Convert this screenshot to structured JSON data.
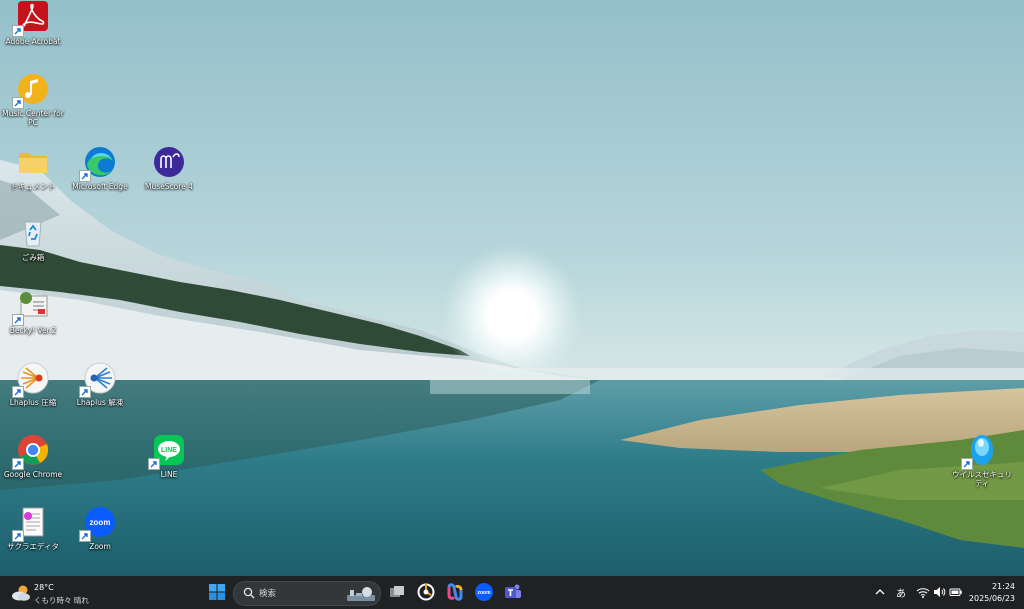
{
  "desktop": {
    "icons": [
      {
        "label": "Adobe Acrobat",
        "icon": "adobe-acrobat-icon"
      },
      {
        "label": "Music Center for PC",
        "icon": "music-center-icon"
      },
      {
        "label": "ドキュメント",
        "icon": "folder-icon"
      },
      {
        "label": "Microsoft Edge",
        "icon": "edge-icon"
      },
      {
        "label": "MuseScore 4",
        "icon": "musescore-icon"
      },
      {
        "label": "ごみ箱",
        "icon": "recycle-bin-icon"
      },
      {
        "label": "Becky! Ver.2",
        "icon": "becky-icon"
      },
      {
        "label": "Lhaplus 圧縮",
        "icon": "lhaplus-compress-icon"
      },
      {
        "label": "Lhaplus 解凍",
        "icon": "lhaplus-extract-icon"
      },
      {
        "label": "Google Chrome",
        "icon": "chrome-icon"
      },
      {
        "label": "LINE",
        "icon": "line-icon"
      },
      {
        "label": "サクラエディタ",
        "icon": "sakura-editor-icon"
      },
      {
        "label": "Zoom",
        "icon": "zoom-icon"
      },
      {
        "label": "ウイルスセキュリティ",
        "icon": "virus-security-icon"
      }
    ]
  },
  "taskbar": {
    "weather": {
      "temp": "28°C",
      "condition": "くもり時々 晴れ"
    },
    "search": {
      "placeholder": "検索"
    },
    "pinned": [
      "start-icon",
      "task-view-icon",
      "media-app-icon",
      "copilot-icon",
      "zoom-icon",
      "teams-icon"
    ],
    "tray": {
      "ime": "あ",
      "time": "21:24",
      "date": "2025/06/23"
    }
  }
}
